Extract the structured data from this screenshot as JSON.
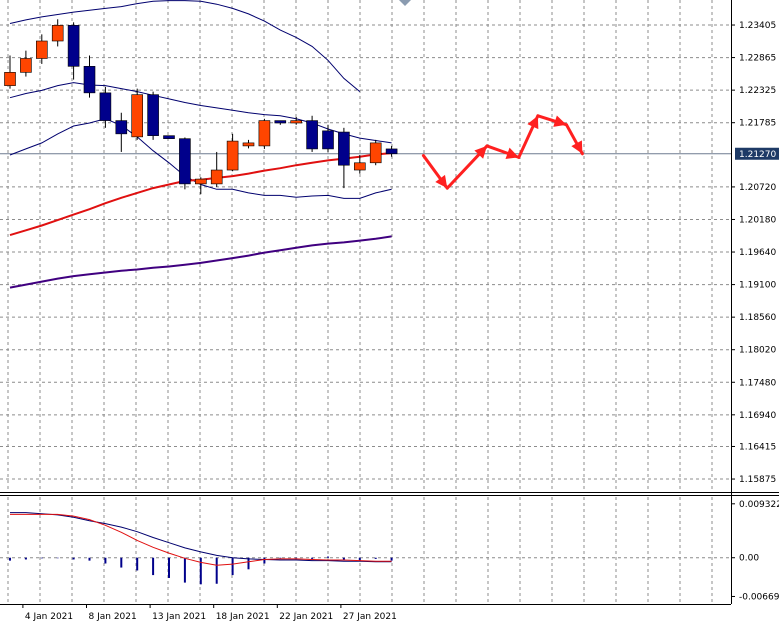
{
  "chart_data": [
    {
      "type": "candlestick",
      "panel": "price",
      "price_scale": {
        "ylim": [
          1.1566,
          1.2382
        ],
        "tick_labels": [
          "1.23405",
          "1.22865",
          "1.22325",
          "1.21785",
          "1.21270",
          "1.20720",
          "1.20180",
          "1.19640",
          "1.19100",
          "1.18560",
          "1.18020",
          "1.17480",
          "1.16940",
          "1.16415",
          "1.15875"
        ],
        "tick_values": [
          1.23405,
          1.22865,
          1.22325,
          1.21785,
          1.2127,
          1.2072,
          1.2018,
          1.1964,
          1.191,
          1.1856,
          1.1802,
          1.1748,
          1.1694,
          1.16415,
          1.15875
        ],
        "current_price": "1.21270",
        "current_value": 1.2127
      },
      "x_ticks": [
        {
          "label": "4 Jan 2021",
          "bar": 1
        },
        {
          "label": "8 Jan 2021",
          "bar": 5
        },
        {
          "label": "13 Jan 2021",
          "bar": 9
        },
        {
          "label": "18 Jan 2021",
          "bar": 13
        },
        {
          "label": "22 Jan 2021",
          "bar": 17
        },
        {
          "label": "27 Jan 2021",
          "bar": 21
        }
      ],
      "candles": [
        {
          "o": 1.224,
          "h": 1.229,
          "l": 1.2235,
          "c": 1.2262
        },
        {
          "o": 1.2262,
          "h": 1.2298,
          "l": 1.2255,
          "c": 1.2285
        },
        {
          "o": 1.2285,
          "h": 1.2325,
          "l": 1.2276,
          "c": 1.2314
        },
        {
          "o": 1.2314,
          "h": 1.235,
          "l": 1.2305,
          "c": 1.234
        },
        {
          "o": 1.234,
          "h": 1.2345,
          "l": 1.225,
          "c": 1.2272
        },
        {
          "o": 1.2272,
          "h": 1.229,
          "l": 1.222,
          "c": 1.2228
        },
        {
          "o": 1.2228,
          "h": 1.2238,
          "l": 1.217,
          "c": 1.2182
        },
        {
          "o": 1.2182,
          "h": 1.2195,
          "l": 1.213,
          "c": 1.216
        },
        {
          "o": 1.2155,
          "h": 1.2235,
          "l": 1.215,
          "c": 1.2225
        },
        {
          "o": 1.2225,
          "h": 1.223,
          "l": 1.215,
          "c": 1.2157
        },
        {
          "o": 1.2157,
          "h": 1.2157,
          "l": 1.2152,
          "c": 1.2152
        },
        {
          "o": 1.2152,
          "h": 1.2154,
          "l": 1.2068,
          "c": 1.2077
        },
        {
          "o": 1.2077,
          "h": 1.2088,
          "l": 1.206,
          "c": 1.2085
        },
        {
          "o": 1.2077,
          "h": 1.213,
          "l": 1.2072,
          "c": 1.21
        },
        {
          "o": 1.21,
          "h": 1.216,
          "l": 1.2098,
          "c": 1.2148
        },
        {
          "o": 1.214,
          "h": 1.215,
          "l": 1.2136,
          "c": 1.2145
        },
        {
          "o": 1.214,
          "h": 1.2185,
          "l": 1.2135,
          "c": 1.2182
        },
        {
          "o": 1.2182,
          "h": 1.2182,
          "l": 1.2175,
          "c": 1.2178
        },
        {
          "o": 1.2178,
          "h": 1.2188,
          "l": 1.2175,
          "c": 1.2182
        },
        {
          "o": 1.2182,
          "h": 1.219,
          "l": 1.213,
          "c": 1.2135
        },
        {
          "o": 1.2165,
          "h": 1.2175,
          "l": 1.213,
          "c": 1.2135
        },
        {
          "o": 1.2163,
          "h": 1.217,
          "l": 1.207,
          "c": 1.2108
        },
        {
          "o": 1.21,
          "h": 1.2125,
          "l": 1.2094,
          "c": 1.2112
        },
        {
          "o": 1.2112,
          "h": 1.215,
          "l": 1.2108,
          "c": 1.2145
        },
        {
          "o": 1.2135,
          "h": 1.214,
          "l": 1.2122,
          "c": 1.2127
        }
      ],
      "colors": {
        "bull": "#ff4500",
        "bear": "#00008b",
        "wick": "#000000"
      },
      "bollinger_upper": [
        1.2343,
        1.2349,
        1.2354,
        1.2358,
        1.2362,
        1.2365,
        1.2368,
        1.2371,
        1.2376,
        1.238,
        1.2381,
        1.2381,
        1.238,
        1.2375,
        1.2368,
        1.2359,
        1.2347,
        1.2332,
        1.232,
        1.2305,
        1.2282,
        1.2252,
        1.223
      ],
      "bollinger_middle": [
        1.222,
        1.2227,
        1.2232,
        1.224,
        1.2245,
        1.2241,
        1.224,
        1.2235,
        1.223,
        1.2224,
        1.2218,
        1.2212,
        1.2207,
        1.2203,
        1.2199,
        1.2195,
        1.2192,
        1.219,
        1.2185,
        1.2178,
        1.2168,
        1.216,
        1.2153,
        1.2149,
        1.2145
      ],
      "bollinger_lower": [
        1.2125,
        1.2135,
        1.2145,
        1.216,
        1.2173,
        1.2178,
        1.2185,
        1.2174,
        1.2155,
        1.2132,
        1.2112,
        1.209,
        1.2076,
        1.2068,
        1.2068,
        1.2062,
        1.2058,
        1.2058,
        1.2055,
        1.2057,
        1.2058,
        1.2053,
        1.2053,
        1.2062,
        1.2068
      ],
      "ma_red": [
        1.1992,
        1.2,
        1.2008,
        1.2017,
        1.2026,
        1.2035,
        1.2045,
        1.2054,
        1.2062,
        1.207,
        1.2076,
        1.2082,
        1.2084,
        1.2087,
        1.209,
        1.2094,
        1.2099,
        1.2103,
        1.2108,
        1.2112,
        1.2116,
        1.2119,
        1.2122,
        1.2126,
        1.2128
      ],
      "ma_purple": [
        1.1905,
        1.191,
        1.1915,
        1.192,
        1.1924,
        1.1927,
        1.193,
        1.1933,
        1.1935,
        1.1938,
        1.194,
        1.1943,
        1.1946,
        1.195,
        1.1954,
        1.1958,
        1.1963,
        1.1967,
        1.1971,
        1.1975,
        1.1978,
        1.198,
        1.1983,
        1.1986,
        1.199
      ],
      "colors_lines": {
        "bollinger": "#00006e",
        "ma_red": "#e01010",
        "ma_purple": "#400080",
        "forecast": "#ff2020"
      },
      "forecast_path": [
        {
          "bar": 26,
          "v": 1.2124
        },
        {
          "bar": 27.5,
          "v": 1.207
        },
        {
          "bar": 30,
          "v": 1.214
        },
        {
          "bar": 32,
          "v": 1.2121
        },
        {
          "bar": 33.2,
          "v": 1.219
        },
        {
          "bar": 35,
          "v": 1.2175
        },
        {
          "bar": 36,
          "v": 1.2127
        }
      ]
    },
    {
      "type": "oscillator",
      "panel": "indicator",
      "ylim": [
        -0.008,
        0.0105
      ],
      "tick_labels": [
        "0.009322",
        "0.00",
        "-0.006698"
      ],
      "tick_values": [
        0.009322,
        0.0,
        -0.006698
      ],
      "histogram": [
        -0.0005,
        -0.0003,
        -0.0001,
        0.0,
        -0.0003,
        -0.0005,
        -0.001,
        -0.0017,
        -0.0022,
        -0.003,
        -0.0035,
        -0.0043,
        -0.0046,
        -0.0045,
        -0.003,
        -0.002,
        -0.001,
        -0.0001,
        0.0,
        -0.0002,
        0.0002,
        -0.0003,
        -0.0006,
        -0.0002,
        -0.0005
      ],
      "signal_dark": [
        0.0078,
        0.0078,
        0.0076,
        0.0074,
        0.007,
        0.0064,
        0.0059,
        0.0053,
        0.0045,
        0.0035,
        0.0026,
        0.0017,
        0.001,
        0.0004,
        0.0,
        -0.0002,
        -0.0003,
        -0.0004,
        -0.0004,
        -0.0005,
        -0.0005,
        -0.0006,
        -0.0006,
        -0.0007,
        -0.0007
      ],
      "signal_red": [
        0.0075,
        0.0075,
        0.0075,
        0.0075,
        0.0072,
        0.0066,
        0.0056,
        0.0044,
        0.003,
        0.0018,
        0.0008,
        -0.0001,
        -0.0008,
        -0.0013,
        -0.0011,
        -0.0007,
        -0.0003,
        -0.0002,
        -0.0002,
        -0.0003,
        -0.0004,
        -0.0004,
        -0.0005,
        -0.0006,
        -0.0006
      ],
      "colors": {
        "histogram": "#00008b",
        "signal_dark": "#00006e",
        "signal_red": "#e01010"
      }
    }
  ]
}
